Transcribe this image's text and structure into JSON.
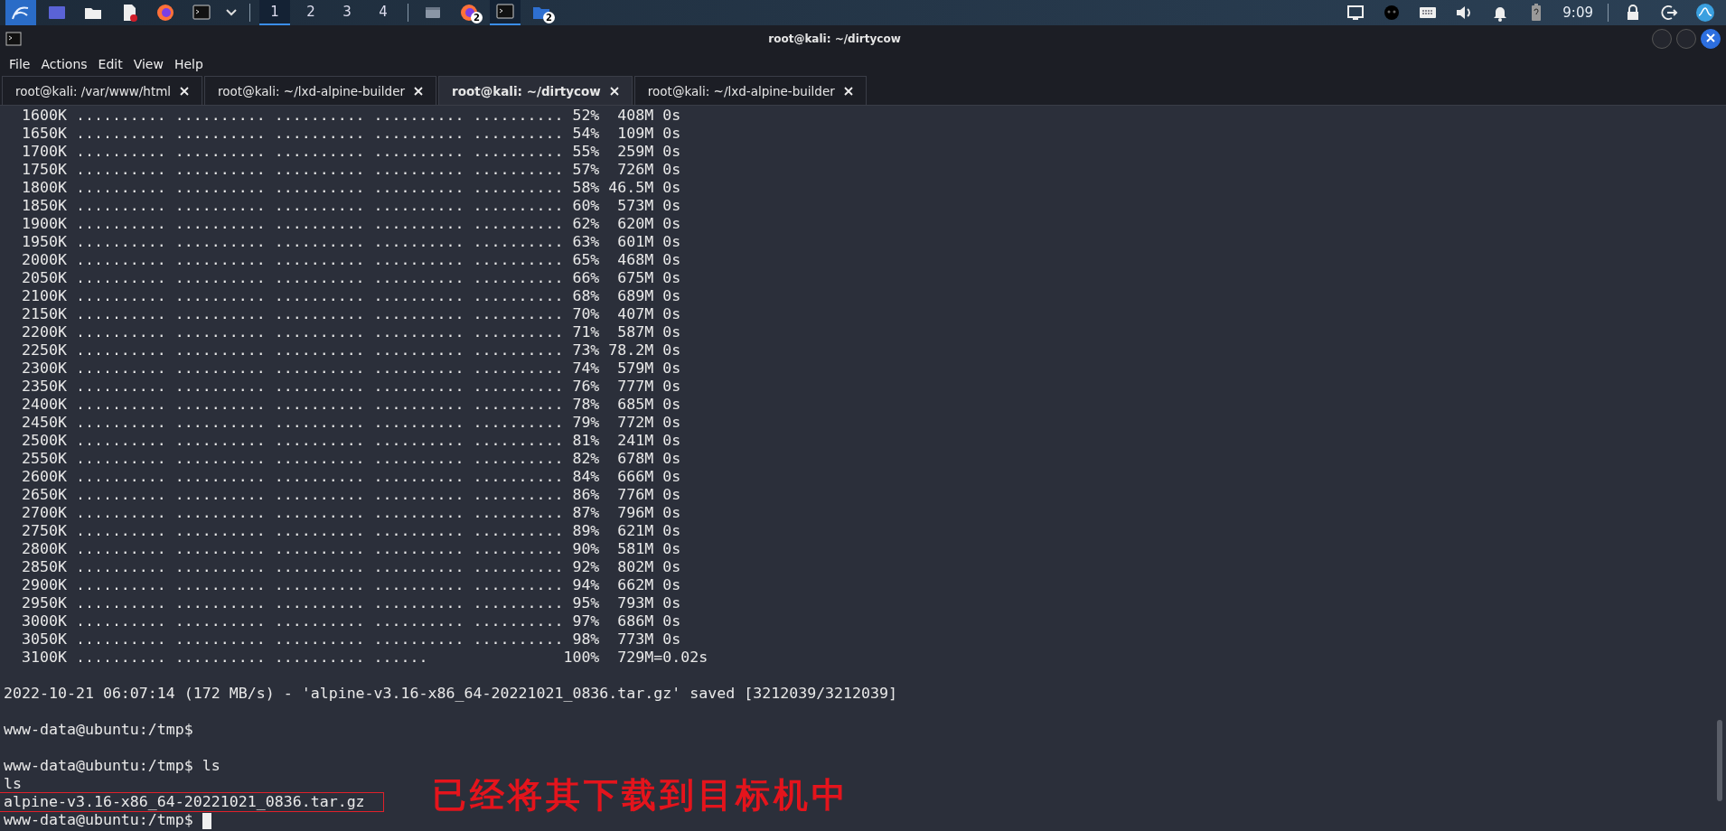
{
  "taskbar": {
    "workspaces": [
      {
        "label": "1",
        "selected": true
      },
      {
        "label": "2",
        "selected": false
      },
      {
        "label": "3",
        "selected": false
      },
      {
        "label": "4",
        "selected": false
      }
    ],
    "windows": [
      {
        "kind": "window",
        "active": false
      },
      {
        "kind": "firefox",
        "badge": "2",
        "active": false
      },
      {
        "kind": "terminal",
        "active": true
      },
      {
        "kind": "folder",
        "badge": "2",
        "active": false
      }
    ],
    "clock": "9:09"
  },
  "window": {
    "title": "root@kali: ~/dirtycow"
  },
  "menu": [
    "File",
    "Actions",
    "Edit",
    "View",
    "Help"
  ],
  "tabs": [
    {
      "label": "root@kali: /var/www/html",
      "selected": false
    },
    {
      "label": "root@kali: ~/lxd-alpine-builder",
      "selected": false
    },
    {
      "label": "root@kali: ~/dirtycow",
      "selected": true
    },
    {
      "label": "root@kali: ~/lxd-alpine-builder",
      "selected": false
    }
  ],
  "terminal": {
    "lines": [
      {
        "kind": "line",
        "text": "  1600K .......... .......... .......... .......... .......... 52%  408M 0s"
      },
      {
        "kind": "line",
        "text": "  1650K .......... .......... .......... .......... .......... 54%  109M 0s"
      },
      {
        "kind": "line",
        "text": "  1700K .......... .......... .......... .......... .......... 55%  259M 0s"
      },
      {
        "kind": "line",
        "text": "  1750K .......... .......... .......... .......... .......... 57%  726M 0s"
      },
      {
        "kind": "line",
        "text": "  1800K .......... .......... .......... .......... .......... 58% 46.5M 0s"
      },
      {
        "kind": "line",
        "text": "  1850K .......... .......... .......... .......... .......... 60%  573M 0s"
      },
      {
        "kind": "line",
        "text": "  1900K .......... .......... .......... .......... .......... 62%  620M 0s"
      },
      {
        "kind": "line",
        "text": "  1950K .......... .......... .......... .......... .......... 63%  601M 0s"
      },
      {
        "kind": "line",
        "text": "  2000K .......... .......... .......... .......... .......... 65%  468M 0s"
      },
      {
        "kind": "line",
        "text": "  2050K .......... .......... .......... .......... .......... 66%  675M 0s"
      },
      {
        "kind": "line",
        "text": "  2100K .......... .......... .......... .......... .......... 68%  689M 0s"
      },
      {
        "kind": "line",
        "text": "  2150K .......... .......... .......... .......... .......... 70%  407M 0s"
      },
      {
        "kind": "line",
        "text": "  2200K .......... .......... .......... .......... .......... 71%  587M 0s"
      },
      {
        "kind": "line",
        "text": "  2250K .......... .......... .......... .......... .......... 73% 78.2M 0s"
      },
      {
        "kind": "line",
        "text": "  2300K .......... .......... .......... .......... .......... 74%  579M 0s"
      },
      {
        "kind": "line",
        "text": "  2350K .......... .......... .......... .......... .......... 76%  777M 0s"
      },
      {
        "kind": "line",
        "text": "  2400K .......... .......... .......... .......... .......... 78%  685M 0s"
      },
      {
        "kind": "line",
        "text": "  2450K .......... .......... .......... .......... .......... 79%  772M 0s"
      },
      {
        "kind": "line",
        "text": "  2500K .......... .......... .......... .......... .......... 81%  241M 0s"
      },
      {
        "kind": "line",
        "text": "  2550K .......... .......... .......... .......... .......... 82%  678M 0s"
      },
      {
        "kind": "line",
        "text": "  2600K .......... .......... .......... .......... .......... 84%  666M 0s"
      },
      {
        "kind": "line",
        "text": "  2650K .......... .......... .......... .......... .......... 86%  776M 0s"
      },
      {
        "kind": "line",
        "text": "  2700K .......... .......... .......... .......... .......... 87%  796M 0s"
      },
      {
        "kind": "line",
        "text": "  2750K .......... .......... .......... .......... .......... 89%  621M 0s"
      },
      {
        "kind": "line",
        "text": "  2800K .......... .......... .......... .......... .......... 90%  581M 0s"
      },
      {
        "kind": "line",
        "text": "  2850K .......... .......... .......... .......... .......... 92%  802M 0s"
      },
      {
        "kind": "line",
        "text": "  2900K .......... .......... .......... .......... .......... 94%  662M 0s"
      },
      {
        "kind": "line",
        "text": "  2950K .......... .......... .......... .......... .......... 95%  793M 0s"
      },
      {
        "kind": "line",
        "text": "  3000K .......... .......... .......... .......... .......... 97%  686M 0s"
      },
      {
        "kind": "line",
        "text": "  3050K .......... .......... .......... .......... .......... 98%  773M 0s"
      },
      {
        "kind": "line",
        "text": "  3100K .......... .......... .......... ......               100%  729M=0.02s"
      },
      {
        "kind": "blank"
      },
      {
        "kind": "line",
        "text": "2022-10-21 06:07:14 (172 MB/s) - 'alpine-v3.16-x86_64-20221021_0836.tar.gz' saved [3212039/3212039]"
      },
      {
        "kind": "blank"
      },
      {
        "kind": "line",
        "text": "www-data@ubuntu:/tmp$"
      },
      {
        "kind": "blank"
      },
      {
        "kind": "line",
        "text": "www-data@ubuntu:/tmp$ ls"
      },
      {
        "kind": "line",
        "text": "ls"
      },
      {
        "kind": "boxed",
        "text": "alpine-v3.16-x86_64-20221021_0836.tar.gz"
      },
      {
        "kind": "cursor",
        "text": "www-data@ubuntu:/tmp$"
      }
    ]
  },
  "annotation": {
    "text": "已经将其下载到目标机中"
  }
}
